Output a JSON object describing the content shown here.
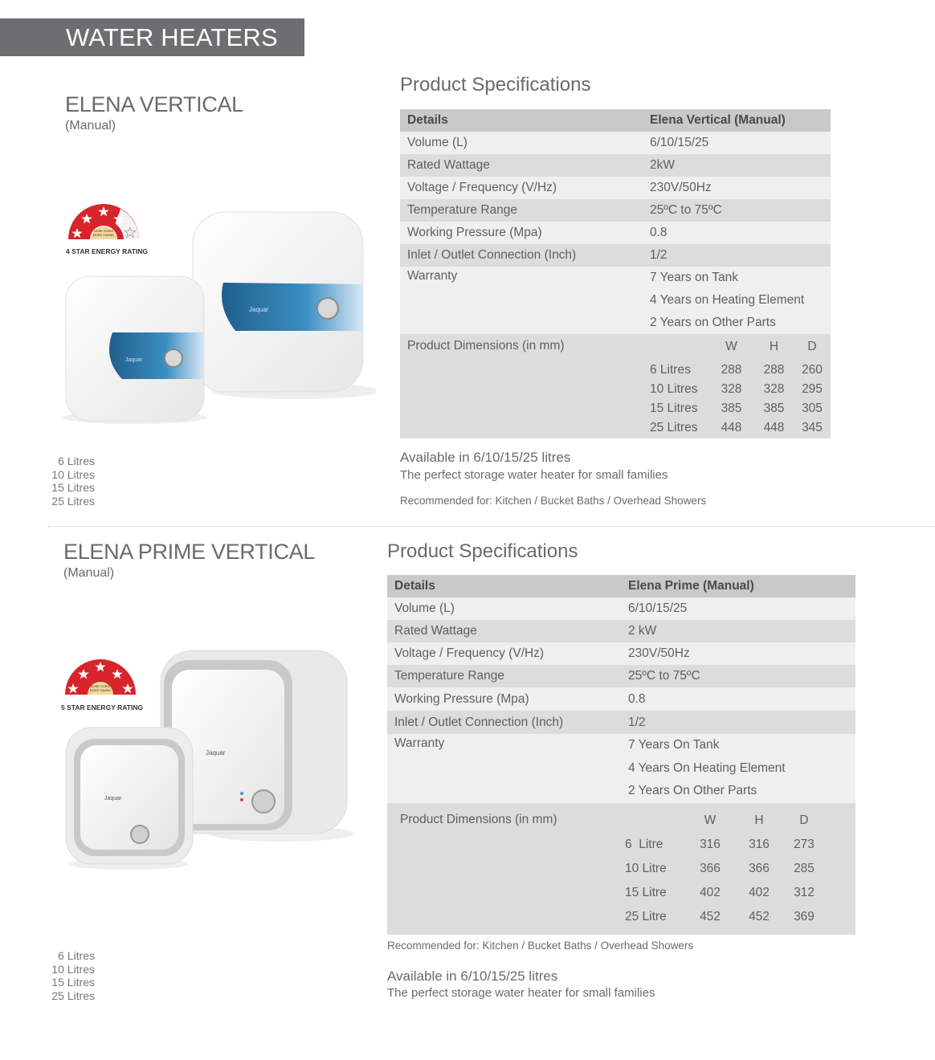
{
  "header": {
    "title": "WATER HEATERS"
  },
  "products": [
    {
      "name": "ELENA VERTICAL",
      "mode": "(Manual)",
      "badge": {
        "caption": "4 STAR ENERGY RATING",
        "stars": 4,
        "arc_text_1": "MORE STARS",
        "arc_text_2": "MORE SAVING"
      },
      "brand_mark": "Jaquar",
      "litres": [
        "6 Litres",
        "10 Litres",
        "15 Litres",
        "25 Litres"
      ],
      "spec_heading": "Product Specifications",
      "table": {
        "header": [
          "Details",
          "Elena Vertical (Manual)"
        ],
        "rows": [
          [
            "Volume (L)",
            "6/10/15/25"
          ],
          [
            "Rated Wattage",
            "2kW"
          ],
          [
            "Voltage / Frequency (V/Hz)",
            "230V/50Hz"
          ],
          [
            "Temperature Range",
            "25ºC to 75ºC"
          ],
          [
            "Working Pressure (Mpa)",
            "0.8"
          ],
          [
            "Inlet / Outlet Connection (Inch)",
            "1/2"
          ]
        ],
        "warranty_label": "Warranty",
        "warranty": [
          "7 Years on Tank",
          "4 Years on Heating Element",
          "2 Years on Other Parts"
        ],
        "dimensions_label": "Product Dimensions (in mm)",
        "dim_cols": [
          "W",
          "H",
          "D"
        ],
        "dim_rows": [
          [
            "6 Litres",
            "288",
            "288",
            "260"
          ],
          [
            "10 Litres",
            "328",
            "328",
            "295"
          ],
          [
            "15 Litres",
            "385",
            "385",
            "305"
          ],
          [
            "25 Litres",
            "448",
            "448",
            "345"
          ]
        ]
      },
      "available": "Available in 6/10/15/25 litres",
      "tagline": "The perfect storage water heater for small families",
      "recommended": "Recommended for: Kitchen / Bucket Baths / Overhead Showers"
    },
    {
      "name": "ELENA PRIME VERTICAL",
      "mode": "(Manual)",
      "badge": {
        "caption": "5 STAR ENERGY RATING",
        "stars": 5,
        "arc_text_1": "MORE STARS",
        "arc_text_2": "MORE SAVING"
      },
      "brand_mark": "Jaquar",
      "litres": [
        "6 Litres",
        "10 Litres",
        "15 Litres",
        "25 Litres"
      ],
      "spec_heading": "Product Specifications",
      "table": {
        "header": [
          "Details",
          "Elena Prime (Manual)"
        ],
        "rows": [
          [
            "Volume (L)",
            "6/10/15/25"
          ],
          [
            "Rated Wattage",
            "2 kW"
          ],
          [
            "Voltage / Frequency (V/Hz)",
            "230V/50Hz"
          ],
          [
            "Temperature Range",
            "25ºC to 75ºC"
          ],
          [
            "Working Pressure (Mpa)",
            "0.8"
          ],
          [
            "Inlet / Outlet Connection (Inch)",
            "1/2"
          ]
        ],
        "warranty_label": "Warranty",
        "warranty": [
          "7 Years On Tank",
          "4 Years On Heating Element",
          "2 Years On Other Parts"
        ],
        "dimensions_label": "Product Dimensions (in mm)",
        "dim_cols": [
          "W",
          "H",
          "D"
        ],
        "dim_rows": [
          [
            "6  Litre",
            "316",
            "316",
            "273"
          ],
          [
            "10 Litre",
            "366",
            "366",
            "285"
          ],
          [
            "15 Litre",
            "402",
            "402",
            "312"
          ],
          [
            "25 Litre",
            "452",
            "452",
            "369"
          ]
        ]
      },
      "recommended": "Recommended for: Kitchen / Bucket Baths / Overhead Showers",
      "available": "Available in 6/10/15/25 litres",
      "tagline": "The perfect storage water heater for small families"
    }
  ]
}
